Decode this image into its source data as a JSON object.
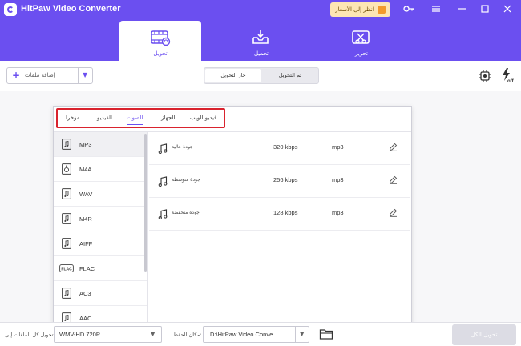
{
  "window": {
    "title": "HitPaw Video Converter",
    "promo_label": "انظر إلى الأسعار",
    "controls": [
      "key-icon",
      "menu-icon",
      "minimize-icon",
      "maximize-icon",
      "close-icon"
    ]
  },
  "top_tabs": [
    {
      "label": "تحويل",
      "icon": "film-convert-icon",
      "active": true
    },
    {
      "label": "تحميل",
      "icon": "download-tray-icon",
      "active": false
    },
    {
      "label": "تحرير",
      "icon": "edit-cut-icon",
      "active": false
    }
  ],
  "toolbar": {
    "add_files_label": "إضافة ملفات",
    "seg_converting": "جار التحويل",
    "seg_converted": "تم التحويل"
  },
  "format_panel": {
    "categories": [
      {
        "label": "مؤخرا",
        "active": false
      },
      {
        "label": "الفيديو",
        "active": false
      },
      {
        "label": "الصوت",
        "active": true
      },
      {
        "label": "الجهاز",
        "active": false
      },
      {
        "label": "فيديو الويب",
        "active": false
      }
    ],
    "formats": [
      {
        "name": "MP3",
        "active": true
      },
      {
        "name": "M4A",
        "active": false
      },
      {
        "name": "WAV",
        "active": false
      },
      {
        "name": "M4R",
        "active": false
      },
      {
        "name": "AIFF",
        "active": false
      },
      {
        "name": "FLAC",
        "active": false
      },
      {
        "name": "AC3",
        "active": false
      },
      {
        "name": "AAC",
        "active": false
      }
    ],
    "qualities": [
      {
        "name": "جودة عالية",
        "bitrate": "320 kbps",
        "format": "mp3"
      },
      {
        "name": "جودة متوسطة",
        "bitrate": "256 kbps",
        "format": "mp3"
      },
      {
        "name": "جودة منخفضة",
        "bitrate": "128 kbps",
        "format": "mp3"
      }
    ]
  },
  "bottom": {
    "convert_all_to_label": "تحويل كل الملفات إلى:",
    "format_value": "WMV-HD 720P",
    "save_to_label": "مكان الحفظ:",
    "path_value": "D:\\HitPaw Video Conve...",
    "convert_all_button": "تحويل الكل"
  },
  "colors": {
    "brand": "#6b4ff0",
    "highlight_box": "#d9232e",
    "promo_bg": "#fde6b4"
  }
}
